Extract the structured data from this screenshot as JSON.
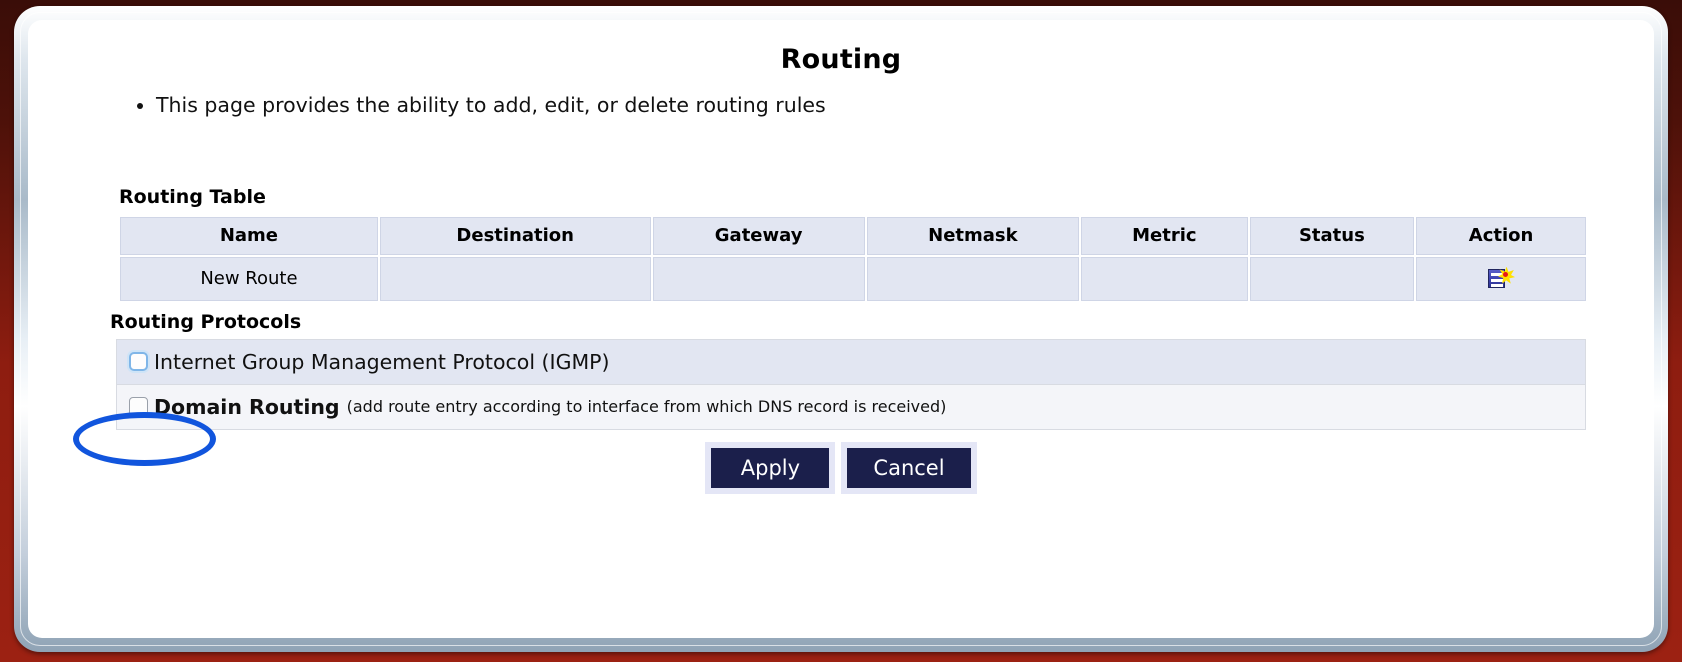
{
  "window": {
    "background_color": "#8f1c10",
    "bezel_color": "#c3cedb"
  },
  "page": {
    "title": "Routing",
    "bullets": [
      "This page provides the ability to add, edit, or delete routing rules"
    ]
  },
  "routing_table": {
    "label": "Routing Table",
    "columns": [
      "Name",
      "Destination",
      "Gateway",
      "Netmask",
      "Metric",
      "Status",
      "Action"
    ],
    "rows": [
      {
        "name": "New Route",
        "name_color": "#ee0000",
        "destination": "",
        "gateway": "",
        "netmask": "",
        "metric": "",
        "status": "",
        "action_icon": "add-new-route-icon"
      }
    ]
  },
  "routing_protocols": {
    "label": "Routing Protocols",
    "items": [
      {
        "name": "Internet Group Management Protocol (IGMP)",
        "hint": "",
        "checked": false,
        "focused": true
      },
      {
        "name": "Domain Routing",
        "hint": "(add route entry according to interface from which DNS record is received)",
        "checked": false,
        "focused": false
      }
    ]
  },
  "buttons": {
    "apply_label": "Apply",
    "cancel_label": "Cancel",
    "accent_color": "#1b1f4b"
  },
  "annotation": {
    "shape": "ellipse",
    "color": "#1155dd",
    "target": "igmp-checkbox"
  }
}
